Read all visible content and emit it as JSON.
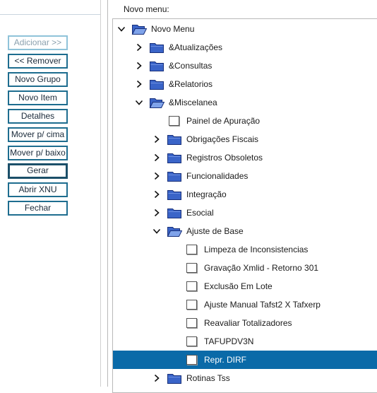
{
  "left_buttons": [
    {
      "label": "Adicionar >>",
      "enabled": false
    },
    {
      "label": "<< Remover",
      "enabled": true
    },
    {
      "label": "Novo Grupo",
      "enabled": true
    },
    {
      "label": "Novo Item",
      "enabled": true
    },
    {
      "label": "Detalhes",
      "enabled": true
    },
    {
      "label": "Mover p/ cima",
      "enabled": true
    },
    {
      "label": "Mover p/ baixo",
      "enabled": true
    },
    {
      "label": "Gerar",
      "enabled": true
    },
    {
      "label": "Abrir XNU",
      "enabled": true
    },
    {
      "label": "Fechar",
      "enabled": true
    }
  ],
  "menu_label": "Novo menu:",
  "tree": [
    {
      "label": "Novo Menu",
      "type": "folder",
      "state": "expanded",
      "level": 0
    },
    {
      "label": "&Atualizações",
      "type": "folder",
      "state": "collapsed",
      "level": 1
    },
    {
      "label": "&Consultas",
      "type": "folder",
      "state": "collapsed",
      "level": 1
    },
    {
      "label": "&Relatorios",
      "type": "folder",
      "state": "collapsed",
      "level": 1
    },
    {
      "label": "&Miscelanea",
      "type": "folder",
      "state": "expanded",
      "level": 1
    },
    {
      "label": "Painel de Apuração",
      "type": "item",
      "level": 2
    },
    {
      "label": "Obrigações Fiscais",
      "type": "folder",
      "state": "collapsed",
      "level": 2
    },
    {
      "label": "Registros Obsoletos",
      "type": "folder",
      "state": "collapsed",
      "level": 2
    },
    {
      "label": "Funcionalidades",
      "type": "folder",
      "state": "collapsed",
      "level": 2
    },
    {
      "label": "Integração",
      "type": "folder",
      "state": "collapsed",
      "level": 2
    },
    {
      "label": "Esocial",
      "type": "folder",
      "state": "collapsed",
      "level": 2
    },
    {
      "label": "Ajuste de Base",
      "type": "folder",
      "state": "expanded",
      "level": 2
    },
    {
      "label": "Limpeza de Inconsistencias",
      "type": "item",
      "level": 3
    },
    {
      "label": "Gravação Xmlid - Retorno 301",
      "type": "item",
      "level": 3
    },
    {
      "label": "Exclusão Em Lote",
      "type": "item",
      "level": 3
    },
    {
      "label": "Ajuste Manual Tafst2 X Tafxerp",
      "type": "item",
      "level": 3
    },
    {
      "label": "Reavaliar Totalizadores",
      "type": "item",
      "level": 3
    },
    {
      "label": "TAFUPDV3N",
      "type": "item",
      "level": 3
    },
    {
      "label": "Repr. DIRF",
      "type": "item",
      "level": 3,
      "selected": true
    },
    {
      "label": "Rotinas Tss",
      "type": "folder",
      "state": "collapsed",
      "level": 2
    }
  ],
  "colors": {
    "selection": "#0a6aa8",
    "button_border": "#1e6d8f",
    "folder_fill": "#3a64c8"
  }
}
